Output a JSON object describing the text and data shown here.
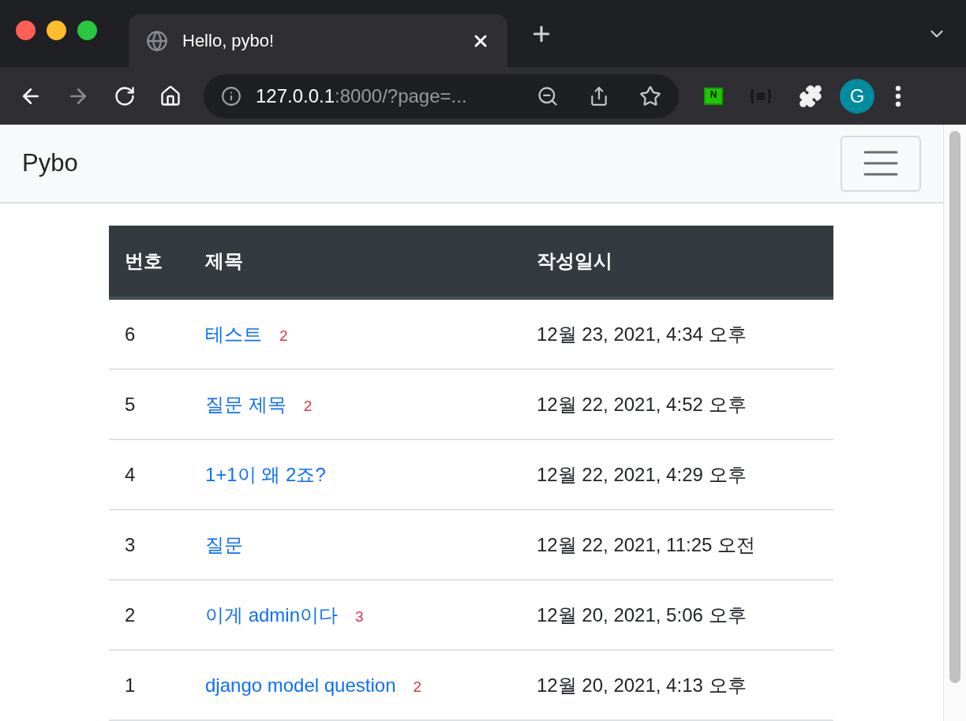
{
  "browser": {
    "tab": {
      "title": "Hello, pybo!",
      "selected": true
    },
    "address": {
      "host": "127.0.0.1",
      "rest": ":8000/?page=..."
    },
    "extensions": [
      {
        "kind": "naver",
        "label": "N"
      },
      {
        "kind": "json"
      },
      {
        "kind": "puzzle"
      }
    ],
    "profile": {
      "initial": "G"
    }
  },
  "navbar": {
    "brand": "Pybo"
  },
  "table": {
    "columns": [
      "번호",
      "제목",
      "작성일시"
    ],
    "rows": [
      {
        "number": "6",
        "subject": {
          "title": "테스트",
          "answer_count": "2"
        },
        "date": "12월 23, 2021, 4:34 오후"
      },
      {
        "number": "5",
        "subject": {
          "title": "질문 제목",
          "answer_count": "2"
        },
        "date": "12월 22, 2021, 4:52 오후"
      },
      {
        "number": "4",
        "subject": {
          "title": "1+1이 왜 2죠?"
        },
        "date": "12월 22, 2021, 4:29 오후"
      },
      {
        "number": "3",
        "subject": {
          "title": "질문"
        },
        "date": "12월 22, 2021, 11:25 오전"
      },
      {
        "number": "2",
        "subject": {
          "title": "이게 admin이다",
          "answer_count": "3"
        },
        "date": "12월 20, 2021, 5:06 오후"
      },
      {
        "number": "1",
        "subject": {
          "title": "django model question",
          "answer_count": "2"
        },
        "date": "12월 20, 2021, 4:13 오후"
      }
    ]
  }
}
